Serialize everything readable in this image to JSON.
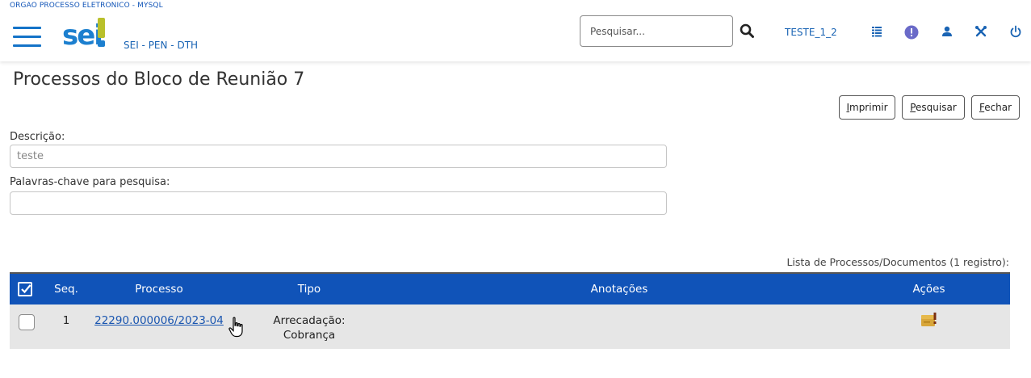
{
  "header": {
    "org_name": "ORGAO PROCESSO ELETRONICO - MYSQL",
    "logo_text": "sei",
    "unit_name": "SEI - PEN - DTH",
    "search_placeholder": "Pesquisar...",
    "user": "TESTE_1_2",
    "icons": [
      "menu-icon",
      "search-icon",
      "grid-icon",
      "alert-icon",
      "user-icon",
      "tools-icon",
      "power-icon"
    ],
    "colors": {
      "brand_blue": "#1c7fcf",
      "brand_green": "#b9c02b",
      "table_header": "#1053b8"
    }
  },
  "page": {
    "title": "Processos do Bloco de Reunião 7",
    "buttons": {
      "print_first": "I",
      "print_rest": "mprimir",
      "search_first": "P",
      "search_rest": "esquisar",
      "close_first": "F",
      "close_rest": "echar"
    }
  },
  "form": {
    "description_label": "Descrição:",
    "description_value": "teste",
    "keywords_label": "Palavras-chave para pesquisa:",
    "keywords_value": ""
  },
  "table": {
    "caption": "Lista de Processos/Documentos (1 registro):",
    "columns": [
      "",
      "Seq.",
      "Processo",
      "Tipo",
      "Anotações",
      "Ações"
    ],
    "rows": [
      {
        "seq": "1",
        "processo": "22290.000006/2023-04",
        "tipo_line1": "Arrecadação:",
        "tipo_line2": "Cobrança",
        "anotacoes": ""
      }
    ]
  }
}
